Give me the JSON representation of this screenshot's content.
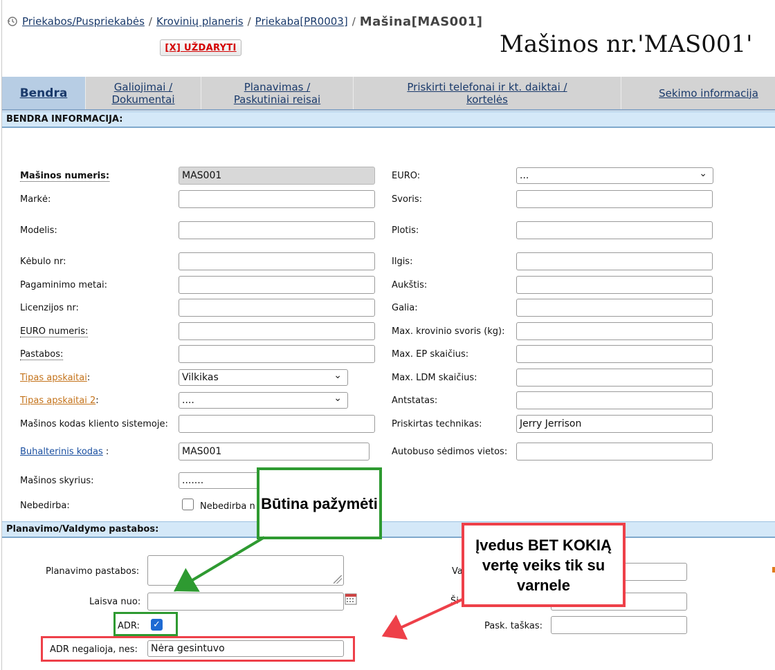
{
  "breadcrumb": {
    "items": [
      "Priekabos/Puspriekabės",
      "Krovinių planeris",
      "Priekaba[PR0003]"
    ],
    "current": "Mašina[MAS001]",
    "separator": "/"
  },
  "close_button": "[X] UŽDARYTI",
  "page_title": "Mašinos nr.'MAS001'",
  "tabs": [
    {
      "line1": "Bendra",
      "line2": ""
    },
    {
      "line1": "Galiojimai /",
      "line2": "Dokumentai"
    },
    {
      "line1": "Planavimas /",
      "line2": "Paskutiniai reisai"
    },
    {
      "line1": "Priskirti telefonai ir kt. daiktai /",
      "line2": "kortelės"
    },
    {
      "line1": "Sekimo informacija",
      "line2": ""
    }
  ],
  "section1": "BENDRA INFORMACIJA:",
  "section2": "Planavimo/Valdymo pastabos:",
  "left_fields": {
    "masinos_numeris": {
      "label": "Mašinos numeris:",
      "value": "MAS001"
    },
    "marke": {
      "label": "Markė:",
      "value": ""
    },
    "modelis": {
      "label": "Modelis:",
      "value": ""
    },
    "kebulo_nr": {
      "label": "Kėbulo nr:",
      "value": ""
    },
    "pagaminimo_metai": {
      "label": "Pagaminimo metai:",
      "value": ""
    },
    "licenzijos_nr": {
      "label": "Licenzijos nr:",
      "value": ""
    },
    "euro_numeris": {
      "label": "EURO numeris:",
      "value": ""
    },
    "pastabos": {
      "label": "Pastabos:",
      "value": ""
    },
    "tipas_apskaitai": {
      "label": "Tipas apskaitai",
      "suffix": ":",
      "value": "Vilkikas"
    },
    "tipas_apskaitai_2": {
      "label": "Tipas apskaitai 2",
      "suffix": ":",
      "value": "...."
    },
    "kodas_kliento": {
      "label": "Mašinos kodas kliento sistemoje:",
      "value": ""
    },
    "buhalterinis": {
      "label": "Buhalterinis kodas",
      "suffix": " :",
      "value": "MAS001"
    },
    "skyrius": {
      "label": "Mašinos skyrius:",
      "value": "......."
    },
    "nebedirba": {
      "label": "Nebedirba:",
      "checkbox_label": "Nebedirba n"
    }
  },
  "right_fields": {
    "euro": {
      "label": "EURO:",
      "value": "..."
    },
    "svoris": {
      "label": "Svoris:",
      "value": ""
    },
    "plotis": {
      "label": "Plotis:",
      "value": ""
    },
    "ilgis": {
      "label": "Ilgis:",
      "value": ""
    },
    "aukstis": {
      "label": "Aukštis:",
      "value": ""
    },
    "galia": {
      "label": "Galia:",
      "value": ""
    },
    "max_svoris": {
      "label": "Max. krovinio svoris (kg):",
      "value": ""
    },
    "max_ep": {
      "label": "Max. EP skaičius:",
      "value": ""
    },
    "max_ldm": {
      "label": "Max. LDM skaičius:",
      "value": ""
    },
    "antstatas": {
      "label": "Antstatas:",
      "value": ""
    },
    "technikas": {
      "label": "Priskirtas technikas:",
      "value": "Jerry Jerrison"
    },
    "sedimos_vietos": {
      "label": "Autobuso sėdimos vietos:",
      "value": ""
    }
  },
  "planning": {
    "pastabos": {
      "label": "Planavimo pastabos:",
      "value": ""
    },
    "laisva_nuo": {
      "label": "Laisva nuo:",
      "value": ""
    },
    "adr": {
      "label": "ADR:",
      "checked": true
    },
    "adr_negalioja": {
      "label": "ADR negalioja, nes:",
      "value": "Nėra gesintuvo"
    },
    "right_partial_1": "Va",
    "right_partial_2": "Ši",
    "pask_taskas": {
      "label": "Pask. taškas:",
      "value": ""
    }
  },
  "annotations": {
    "note_green": "Būtina pažymėti",
    "note_red": "Įvedus  BET KOKIĄ vertę veiks tik su varnele",
    "green_color": "#2e9a31",
    "red_color": "#ee4049"
  },
  "icons": {
    "history": "history-icon",
    "calendar": "calendar-icon",
    "resize": "resize-grip-icon"
  }
}
